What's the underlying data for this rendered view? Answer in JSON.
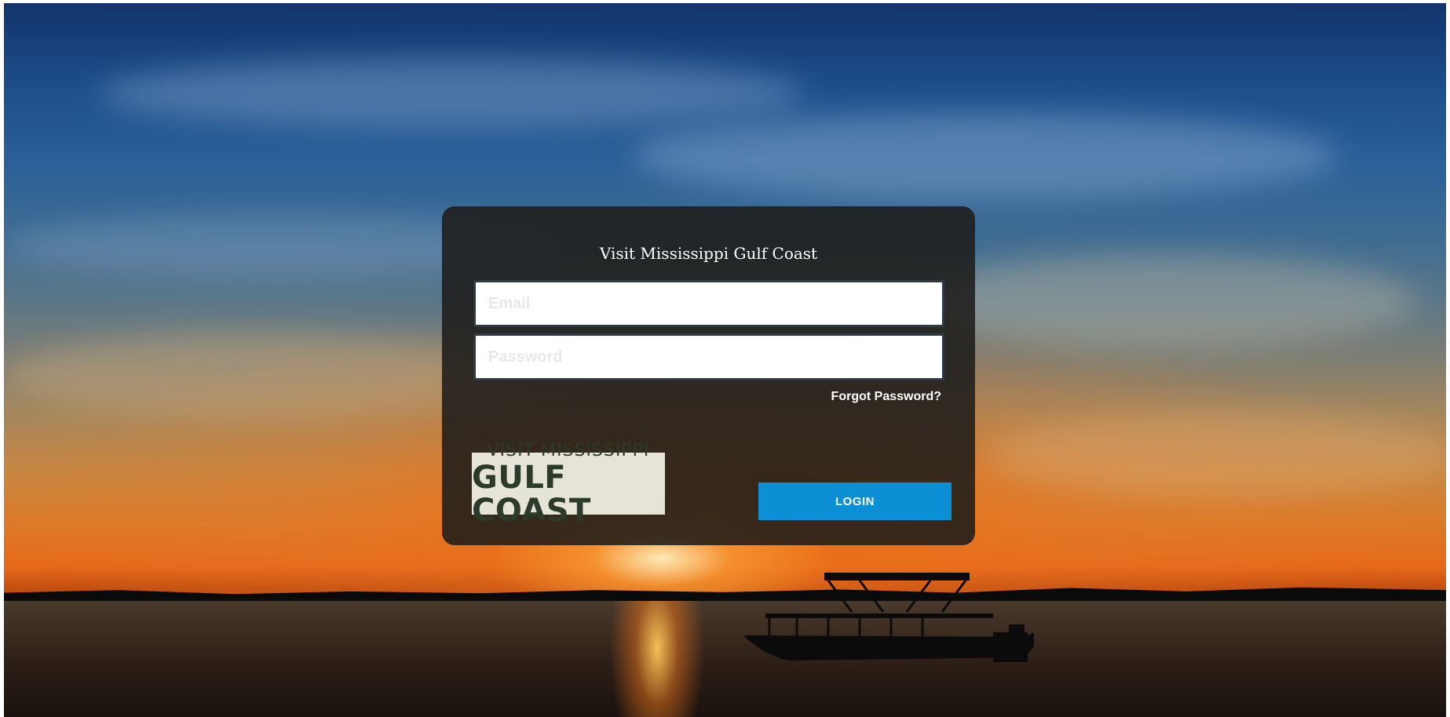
{
  "login": {
    "title": "Visit Mississippi Gulf Coast",
    "email_placeholder": "Email",
    "password_placeholder": "Password",
    "forgot_password": "Forgot Password?",
    "login_button": "LOGIN"
  },
  "logo": {
    "line1": "VISIT MISSISSIPPI",
    "line2": "GULF COAST"
  },
  "colors": {
    "button": "#0c8fd4",
    "card": "#1e1c1a",
    "logo_bg": "#e6e4d8",
    "logo_text": "#2b3a2a"
  }
}
